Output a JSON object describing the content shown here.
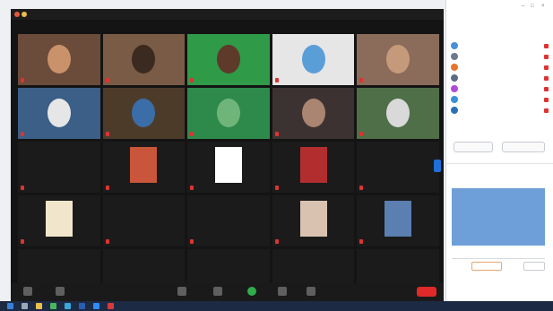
{
  "meeting": {
    "window_title": "",
    "tiles": [
      {
        "name": "",
        "type": "video",
        "bg": "#6b4b3a",
        "fg": "#c9926a"
      },
      {
        "name": "",
        "type": "video",
        "bg": "#7a5b46",
        "fg": "#3a2a20"
      },
      {
        "name": "",
        "type": "video",
        "bg": "#2f9a47",
        "fg": "#5e3a2a"
      },
      {
        "name": "",
        "type": "video",
        "bg": "#e6e6e6",
        "fg": "#5a9ed8"
      },
      {
        "name": "",
        "type": "video",
        "bg": "#8b6b5a",
        "fg": "#c59a7a"
      },
      {
        "name": "",
        "type": "video",
        "bg": "#3b5f86",
        "fg": "#e6e6e6"
      },
      {
        "name": "",
        "type": "video",
        "bg": "#4d3b2a",
        "fg": "#3b6da8"
      },
      {
        "name": "",
        "type": "video",
        "bg": "#2e8a4b",
        "fg": "#6fb57a"
      },
      {
        "name": "",
        "type": "video",
        "bg": "#3d3232",
        "fg": "#a98572"
      },
      {
        "name": "",
        "type": "video",
        "bg": "#4f6f48",
        "fg": "#d9d9d9"
      },
      {
        "name": "",
        "type": "name",
        "bg": "#1b1b1b",
        "fg": ""
      },
      {
        "name": "",
        "type": "photo",
        "bg": "#1b1b1b",
        "fg": "#c9553a"
      },
      {
        "name": "",
        "type": "photo",
        "bg": "#1b1b1b",
        "fg": "#ffffff"
      },
      {
        "name": "",
        "type": "photo",
        "bg": "#1b1b1b",
        "fg": "#b22e2e"
      },
      {
        "name": "",
        "type": "name",
        "bg": "#1b1b1b",
        "fg": ""
      },
      {
        "name": "",
        "type": "photo",
        "bg": "#1b1b1b",
        "fg": "#f1e6cc"
      },
      {
        "name": "",
        "type": "name",
        "bg": "#1b1b1b",
        "fg": ""
      },
      {
        "name": "",
        "type": "name",
        "bg": "#1b1b1b",
        "fg": ""
      },
      {
        "name": "",
        "type": "photo",
        "bg": "#1b1b1b",
        "fg": "#d9c3b0"
      },
      {
        "name": "",
        "type": "photo",
        "bg": "#1b1b1b",
        "fg": "#5a7fb0"
      },
      {
        "name": "",
        "type": "name",
        "bg": "#1b1b1b",
        "fg": ""
      },
      {
        "name": "",
        "type": "name",
        "bg": "#1b1b1b",
        "fg": ""
      },
      {
        "name": "",
        "type": "name",
        "bg": "#1b1b1b",
        "fg": ""
      },
      {
        "name": "",
        "type": "name",
        "bg": "#1b1b1b",
        "fg": ""
      },
      {
        "name": "",
        "type": "name",
        "bg": "#1b1b1b",
        "fg": ""
      }
    ],
    "toolbar": {
      "buttons": [
        "mute-icon",
        "video-icon",
        "participants-icon",
        "chat-icon",
        "share-screen-icon",
        "record-icon",
        "reactions-icon"
      ],
      "end_label": ""
    },
    "accent": "#e02a2a"
  },
  "panel": {
    "title": "",
    "subtitle": "",
    "participants": [
      {
        "name": "",
        "avatar": "#4a8fd8"
      },
      {
        "name": "",
        "avatar": "#6b7a8c"
      },
      {
        "name": "",
        "avatar": "#e8752a"
      },
      {
        "name": "",
        "avatar": "#5b6b86"
      },
      {
        "name": "",
        "avatar": "#b04ad8"
      },
      {
        "name": "",
        "avatar": "#3a8fd8"
      },
      {
        "name": "",
        "avatar": "#2a6fb8"
      }
    ],
    "invite_label": "",
    "mute_all_label": "",
    "more_label": "",
    "chat": {
      "header": "",
      "from_label": "",
      "privately_label": "",
      "message": "",
      "to_label": "",
      "to_target": "",
      "file_label": ""
    }
  },
  "taskbar": {
    "icons": [
      {
        "name": "windows-start-icon",
        "color": "#3a7fd8"
      },
      {
        "name": "search-icon",
        "color": "#9aa8bc"
      },
      {
        "name": "file-explorer-icon",
        "color": "#e8c04a"
      },
      {
        "name": "chrome-icon",
        "color": "#4ab85a"
      },
      {
        "name": "edge-icon",
        "color": "#3aa8d8"
      },
      {
        "name": "word-icon",
        "color": "#2a5fb0"
      },
      {
        "name": "zoom-icon",
        "color": "#2d8cff"
      },
      {
        "name": "pdf-icon",
        "color": "#d83a3a"
      }
    ],
    "clock": ""
  }
}
